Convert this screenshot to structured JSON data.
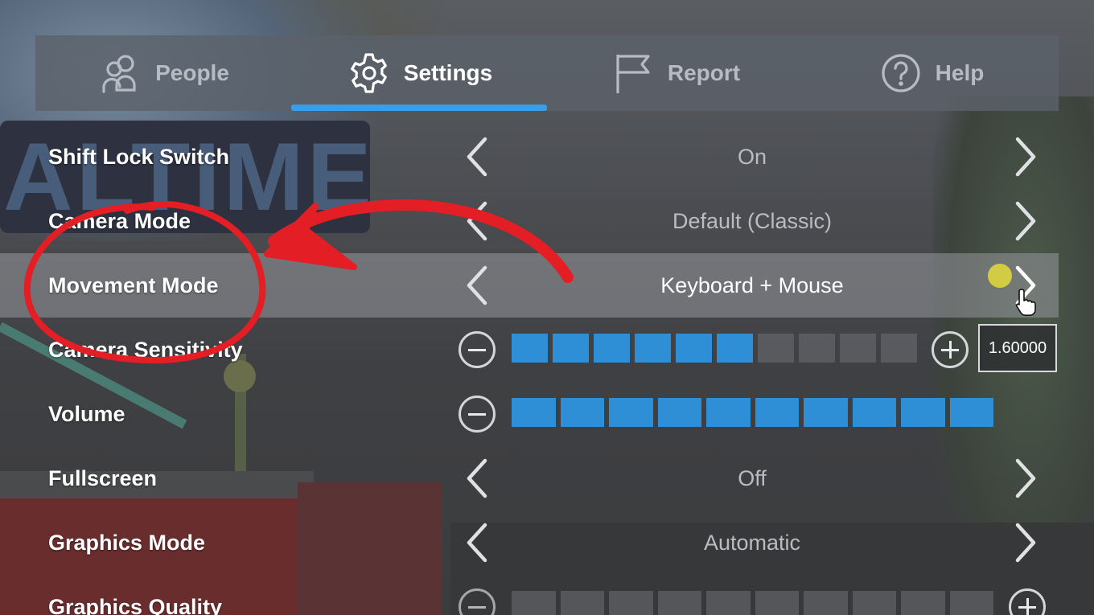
{
  "tabs": [
    {
      "label": "People",
      "icon": "people-icon"
    },
    {
      "label": "Settings",
      "icon": "gear-icon",
      "active": true
    },
    {
      "label": "Report",
      "icon": "flag-icon"
    },
    {
      "label": "Help",
      "icon": "help-icon"
    }
  ],
  "settings": {
    "shift_lock": {
      "label": "Shift Lock Switch",
      "value": "On"
    },
    "camera_mode": {
      "label": "Camera Mode",
      "value": "Default (Classic)"
    },
    "movement_mode": {
      "label": "Movement Mode",
      "value": "Keyboard + Mouse"
    },
    "camera_sensitivity": {
      "label": "Camera Sensitivity",
      "value": "1.60000",
      "level": 0.6
    },
    "volume": {
      "label": "Volume",
      "level": 1.0
    },
    "fullscreen": {
      "label": "Fullscreen",
      "value": "Off"
    },
    "graphics_mode": {
      "label": "Graphics Mode",
      "value": "Automatic"
    },
    "graphics_quality": {
      "label": "Graphics Quality",
      "level": 0.0
    }
  },
  "colors": {
    "accent": "#3a9ee6",
    "slider_on": "#2e8fd6",
    "annotation": "#e31e24",
    "cursor_dot": "#d9d440"
  }
}
